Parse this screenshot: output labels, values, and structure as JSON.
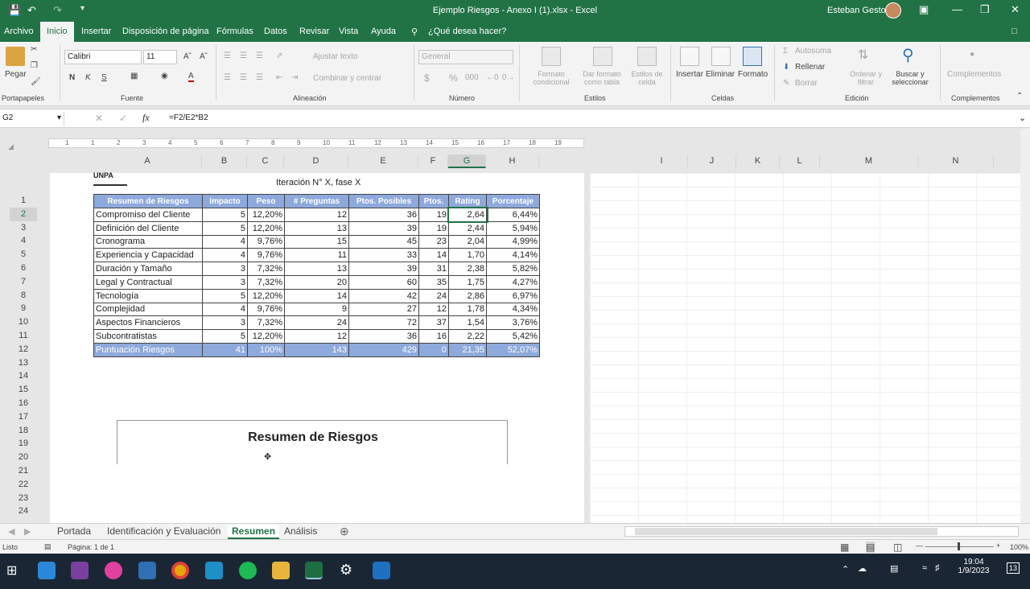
{
  "window": {
    "title": "Ejemplo Riesgos - Anexo I (1).xlsx  -  Excel",
    "user": "Esteban Gesto"
  },
  "ribbon_tabs": [
    "Archivo",
    "Inicio",
    "Insertar",
    "Disposición de página",
    "Fórmulas",
    "Datos",
    "Revisar",
    "Vista",
    "Ayuda"
  ],
  "tell_me": "¿Qué desea hacer?",
  "ribbon": {
    "paste": "Pegar",
    "font_name": "Calibri",
    "font_size": "11",
    "wrap_text": "Ajustar texto",
    "merge_center": "Combinar y centrar",
    "number_format": "General",
    "cond_format": "Formato condicional",
    "format_table": "Dar formato como tabla",
    "cell_styles": "Estilos de celda",
    "insert": "Insertar",
    "delete": "Eliminar",
    "format": "Formato",
    "autosum": "Autosuma",
    "fill": "Rellenar",
    "clear": "Borrar",
    "sort_filter": "Ordenar y filtrar",
    "find_select": "Buscar y seleccionar",
    "addins": "Complementos",
    "groups": {
      "clipboard": "Portapapeles",
      "font": "Fuente",
      "alignment": "Alineación",
      "number": "Número",
      "styles": "Estilos",
      "cells": "Celdas",
      "editing": "Edición",
      "addins": "Complementos"
    }
  },
  "formula_bar": {
    "cell_ref": "G2",
    "formula": "=F2/E2*B2"
  },
  "columns": [
    "A",
    "B",
    "C",
    "D",
    "E",
    "F",
    "G",
    "H",
    "I",
    "J",
    "K",
    "L",
    "M",
    "N"
  ],
  "rows": [
    "1",
    "2",
    "3",
    "4",
    "5",
    "6",
    "7",
    "8",
    "9",
    "10",
    "11",
    "12",
    "13",
    "14",
    "15",
    "16",
    "17",
    "18",
    "19",
    "20",
    "21",
    "22",
    "23",
    "24"
  ],
  "ruler": [
    "1",
    "1",
    "2",
    "3",
    "4",
    "5",
    "6",
    "7",
    "8",
    "9",
    "10",
    "11",
    "12",
    "13",
    "14",
    "15",
    "16",
    "17",
    "18",
    "19"
  ],
  "sheet": {
    "iteration_label": "Iteración N° X, fase X",
    "logo_text": "UNPA",
    "headers": [
      "Resumen de Riesgos",
      "Impacto",
      "Peso",
      "# Preguntas",
      "Ptos. Posibles",
      "Ptos.",
      "Rating",
      "Porcentaje"
    ],
    "rows": [
      [
        "Compromiso del Cliente",
        "5",
        "12,20%",
        "12",
        "36",
        "19",
        "2,64",
        "6,44%"
      ],
      [
        "Definición del Cliente",
        "5",
        "12,20%",
        "13",
        "39",
        "19",
        "2,44",
        "5,94%"
      ],
      [
        "Cronograma",
        "4",
        "9,76%",
        "15",
        "45",
        "23",
        "2,04",
        "4,99%"
      ],
      [
        "Experiencia y Capacidad",
        "4",
        "9,76%",
        "11",
        "33",
        "14",
        "1,70",
        "4,14%"
      ],
      [
        "Duración y Tamaño",
        "3",
        "7,32%",
        "13",
        "39",
        "31",
        "2,38",
        "5,82%"
      ],
      [
        "Legal y Contractual",
        "3",
        "7,32%",
        "20",
        "60",
        "35",
        "1,75",
        "4,27%"
      ],
      [
        "Tecnología",
        "5",
        "12,20%",
        "14",
        "42",
        "24",
        "2,86",
        "6,97%"
      ],
      [
        "Complejidad",
        "4",
        "9,76%",
        "9",
        "27",
        "12",
        "1,78",
        "4,34%"
      ],
      [
        "Aspectos Financieros",
        "3",
        "7,32%",
        "24",
        "72",
        "37",
        "1,54",
        "3,76%"
      ],
      [
        "Subcontratistas",
        "5",
        "12,20%",
        "12",
        "36",
        "16",
        "2,22",
        "5,42%"
      ]
    ],
    "total": [
      "Puntuación Riesgos",
      "41",
      "100%",
      "143",
      "429",
      "0",
      "21,35",
      "52,07%"
    ],
    "chart_title": "Resumen de Riesgos"
  },
  "sheet_tabs": [
    "Portada",
    "Identificación y Evaluación",
    "Resumen",
    "Análisis"
  ],
  "status": {
    "ready": "Listo",
    "page": "Página: 1 de 1",
    "zoom": "100%"
  },
  "taskbar": {
    "time": "19:04",
    "date": "1/9/2023",
    "notif": "13"
  },
  "colors": {
    "excel_green": "#217346",
    "header_blue": "#8ea9db",
    "taskbar": "#1b2634"
  }
}
